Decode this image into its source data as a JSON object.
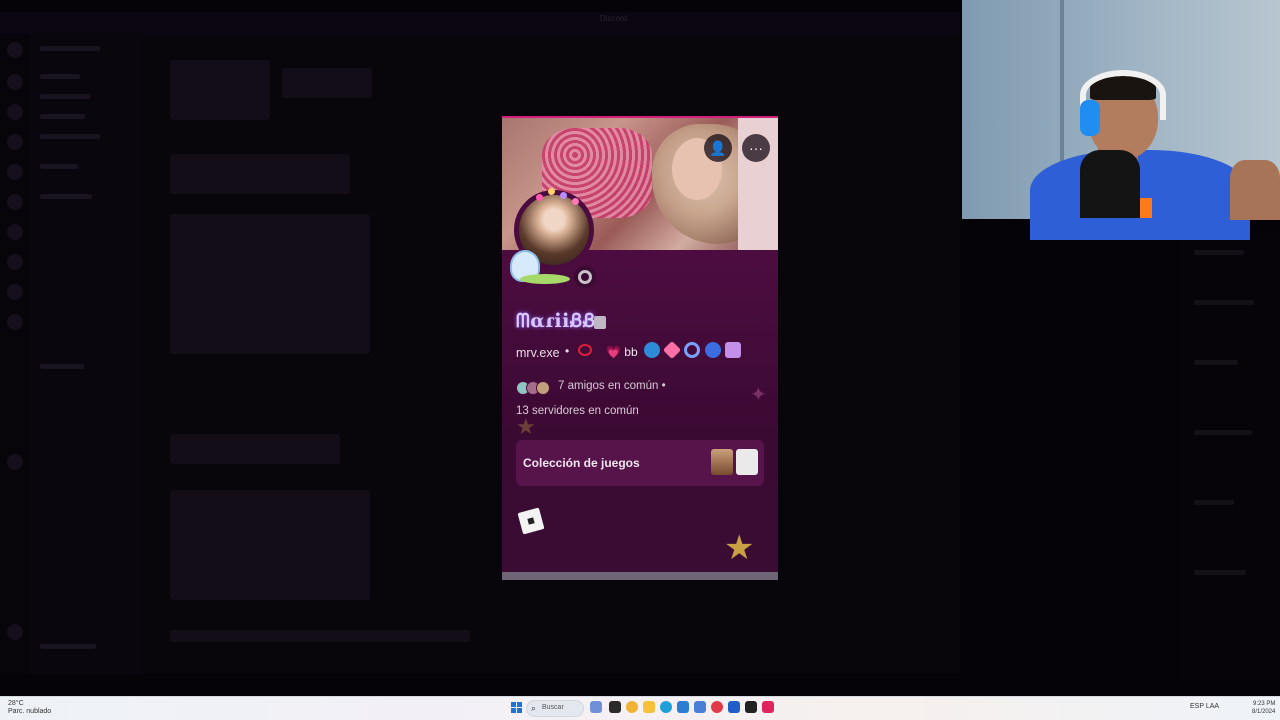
{
  "profile": {
    "display_name": "ᗰαɾiiᏰᏰ",
    "username": "mrv.exe",
    "separator": "•",
    "pronouns": "bb",
    "pronouns_heart": "💗",
    "mutual_friends": "7 amigos en común",
    "mutual_servers": "13 servidores en común",
    "games_collection_label": "Colección de juegos",
    "add_friend_icon": "add-friend-icon",
    "more_icon": "more-options-icon",
    "more_glyph": "···",
    "add_glyph": "👤"
  },
  "app": {
    "window_title": "Discord"
  },
  "taskbar": {
    "search_placeholder": "Buscar",
    "weather_temp": "28°C",
    "weather_desc": "Parc. nublado",
    "lang": "ESP",
    "region": "LAA",
    "time": "9:23 PM",
    "date": "8/1/2024"
  },
  "colors": {
    "profile_accent": "#d0207a",
    "profile_bg": "#4a0c3e",
    "display_name_color": "#d9c8ff"
  }
}
